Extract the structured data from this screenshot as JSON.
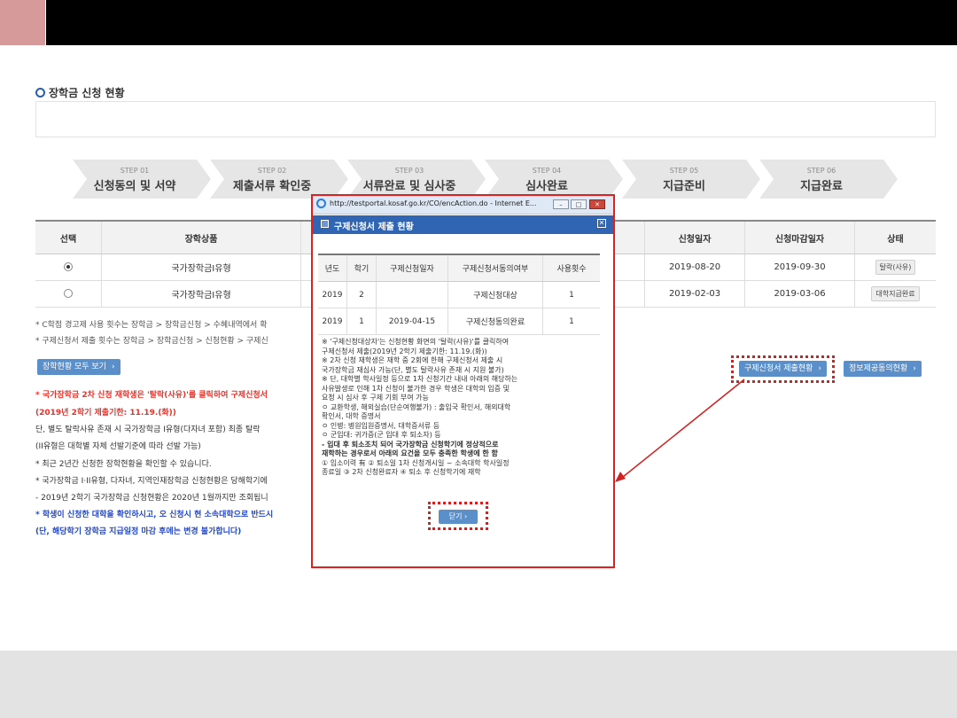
{
  "section_title": "장학금 신청 현황",
  "steps": [
    {
      "num": "STEP 01",
      "name": "신청동의 및 서약"
    },
    {
      "num": "STEP 02",
      "name": "제출서류 확인중"
    },
    {
      "num": "STEP 03",
      "name": "서류완료 및 심사중"
    },
    {
      "num": "STEP 04",
      "name": "심사완료"
    },
    {
      "num": "STEP 05",
      "name": "지급준비"
    },
    {
      "num": "STEP 06",
      "name": "지급완료"
    }
  ],
  "table": {
    "headers": [
      "선택",
      "장학상품",
      "",
      "신청일자",
      "신청마감일자",
      "상태"
    ],
    "rows": [
      {
        "selected": true,
        "product": "국가장학금I유형",
        "apply_date": "2019-08-20",
        "deadline": "2019-09-30",
        "status": "탈락(사유)"
      },
      {
        "selected": false,
        "product": "국가장학금I유형",
        "apply_date": "2019-02-03",
        "deadline": "2019-03-06",
        "status": "대학지급완료"
      }
    ]
  },
  "notes": [
    "* C학점 경고제 사용 횟수는 장학금 > 장학금신청 > 수혜내역에서 확",
    "* 구제신청서 제출 횟수는 장학금 > 장학금신청 > 신청현황 > 구제신"
  ],
  "buttons": {
    "view_all": "장학현황 모두 보기",
    "relief_status": "구제신청서 제출현황",
    "info_consent": "정보제공동의현황"
  },
  "red_lines": [
    {
      "text": "* 국가장학금 2차 신청 재학생은 '탈락(사유)'를 클릭하여 구제신청서",
      "cls": "red"
    },
    {
      "text": "(2019년 2학기 제출기한: 11.19.(화))",
      "cls": "red"
    },
    {
      "text": "단, 별도 탈락사유 존재 시 국가장학금 I유형(다자녀 포함) 최종 탈락",
      "cls": "dark"
    },
    {
      "text": "(II유형은 대학별 자체 선발기준에 따라 선발 가능)",
      "cls": "dark"
    },
    {
      "text": "* 최근 2년간 신청한 장학현황을 확인할 수 있습니다.",
      "cls": "dark"
    },
    {
      "text": "* 국가장학금 I·II유형, 다자녀, 지역인재장학금 신청현황은 당해학기에",
      "cls": "dark"
    },
    {
      "text": "- 2019년 2학기 국가장학금 신청현황은 2020년 1월까지만 조회됩니",
      "cls": "dark"
    },
    {
      "text": "* 학생이 신청한 대학을 확인하시고, 오 신청시 현 소속대학으로 반드시",
      "cls": "blue"
    },
    {
      "text": "(단, 해당학기 장학금 지급일정 마감 후에는 변경 불가합니다)",
      "cls": "blue"
    }
  ],
  "popup": {
    "url": "http://testportal.kosaf.go.kr/CO/encAction.do - Internet E...",
    "title": "구제신청서 제출 현황",
    "headers": [
      "년도",
      "학기",
      "구제신청일자",
      "구제신청서동의여부",
      "사용횟수"
    ],
    "rows": [
      {
        "year": "2019",
        "term": "2",
        "date": "",
        "consent": "구제신청대상",
        "count": "1"
      },
      {
        "year": "2019",
        "term": "1",
        "date": "2019-04-15",
        "consent": "구제신청동의완료",
        "count": "1"
      }
    ],
    "notes": [
      {
        "t": "※ '구제신청대상자'는 신청현황 화면의 '탈락(사유)'를 클릭하여",
        "b": false
      },
      {
        "t": "   구제신청서 제출(2019년 2학기 제출기한: 11.19.(화))",
        "b": false
      },
      {
        "t": "※ 2차 신청 재학생은 재학 중 2회에 한해 구제신청서 제출 시",
        "b": false
      },
      {
        "t": "   국가장학금 재심사 가능(단, 별도 탈락사유 존재 시 지원 불가)",
        "b": false
      },
      {
        "t": "※ 단, 대학별 학사일정 등으로 1차 신청기간 내내 아래의 해당하는",
        "b": false
      },
      {
        "t": "   사유발생로 인해 1차 신청이 불가한 경우 학생은 대학의 입증 및",
        "b": false
      },
      {
        "t": "   요청 시 심사 후 구제 기회 부여 가능",
        "b": false
      },
      {
        "t": " ㅇ 교환학생, 해외실습(단순여행불가) : 출입국 확인서, 해외대학",
        "b": false
      },
      {
        "t": "     확인서, 대학 증명서",
        "b": false
      },
      {
        "t": " ㅇ 인병: 병원입원증명서, 대학증서류 등",
        "b": false
      },
      {
        "t": " ㅇ 군입대: 귀가증(군 입대 후 퇴소자) 등",
        "b": false
      },
      {
        "t": "  - 입대 후 퇴소조치 되어 국가장학금 신청학기에 정상적으로",
        "b": true
      },
      {
        "t": "    재학하는 경우로서 아래의 요건을 모두 충족한 학생에 한 함",
        "b": true
      },
      {
        "t": "    ① 입소이력 有 ② 퇴소일 1차 신청개시일 ~ 소속대학 학사일정",
        "b": false
      },
      {
        "t": "    종료일 ③ 2차 신청완료자 ④ 퇴소 후 신청학기에 재학",
        "b": false
      }
    ],
    "close_label": "닫기"
  },
  "colors": {
    "accent": "#e02020",
    "button": "#5b8fc9",
    "header": "#2f65b3"
  }
}
